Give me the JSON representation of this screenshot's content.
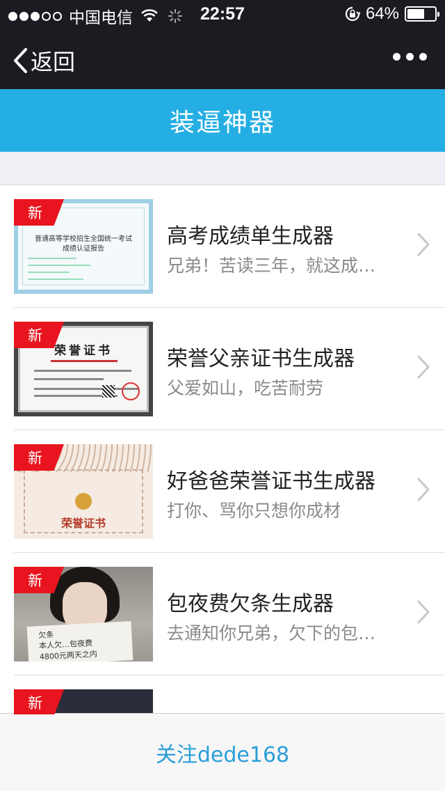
{
  "status_bar": {
    "carrier": "中国电信",
    "time": "22:57",
    "battery": "64%",
    "battery_level": 0.64,
    "signal_bars_filled": 3,
    "signal_bars_total": 5
  },
  "nav": {
    "back_label": "返回"
  },
  "page": {
    "title": "装逼神器"
  },
  "items": [
    {
      "badge": "新",
      "title": "高考成绩单生成器",
      "desc": "兄弟！苦读三年，就这成…"
    },
    {
      "badge": "新",
      "title": "荣誉父亲证书生成器",
      "desc": "父爱如山，吃苦耐劳"
    },
    {
      "badge": "新",
      "title": "好爸爸荣誉证书生成器",
      "desc": "打你、骂你只想你成材"
    },
    {
      "badge": "新",
      "title": "包夜费欠条生成器",
      "desc": "去通知你兄弟，欠下的包…"
    },
    {
      "badge": "新"
    }
  ],
  "thumbs": {
    "t1_line1": "普通高等学校招生全国统一考试",
    "t1_line2": "成绩认证报告",
    "t2_head": "荣誉证书",
    "t3_word": "荣誉证书",
    "t4_note": "欠条\n本人欠…包夜费\n4800元两天之内"
  },
  "footer": {
    "label": "关注dede168"
  },
  "colors": {
    "accent": "#25aee3",
    "badge": "#e8141f",
    "link": "#2a9ed8",
    "bar": "#1c1b21"
  }
}
